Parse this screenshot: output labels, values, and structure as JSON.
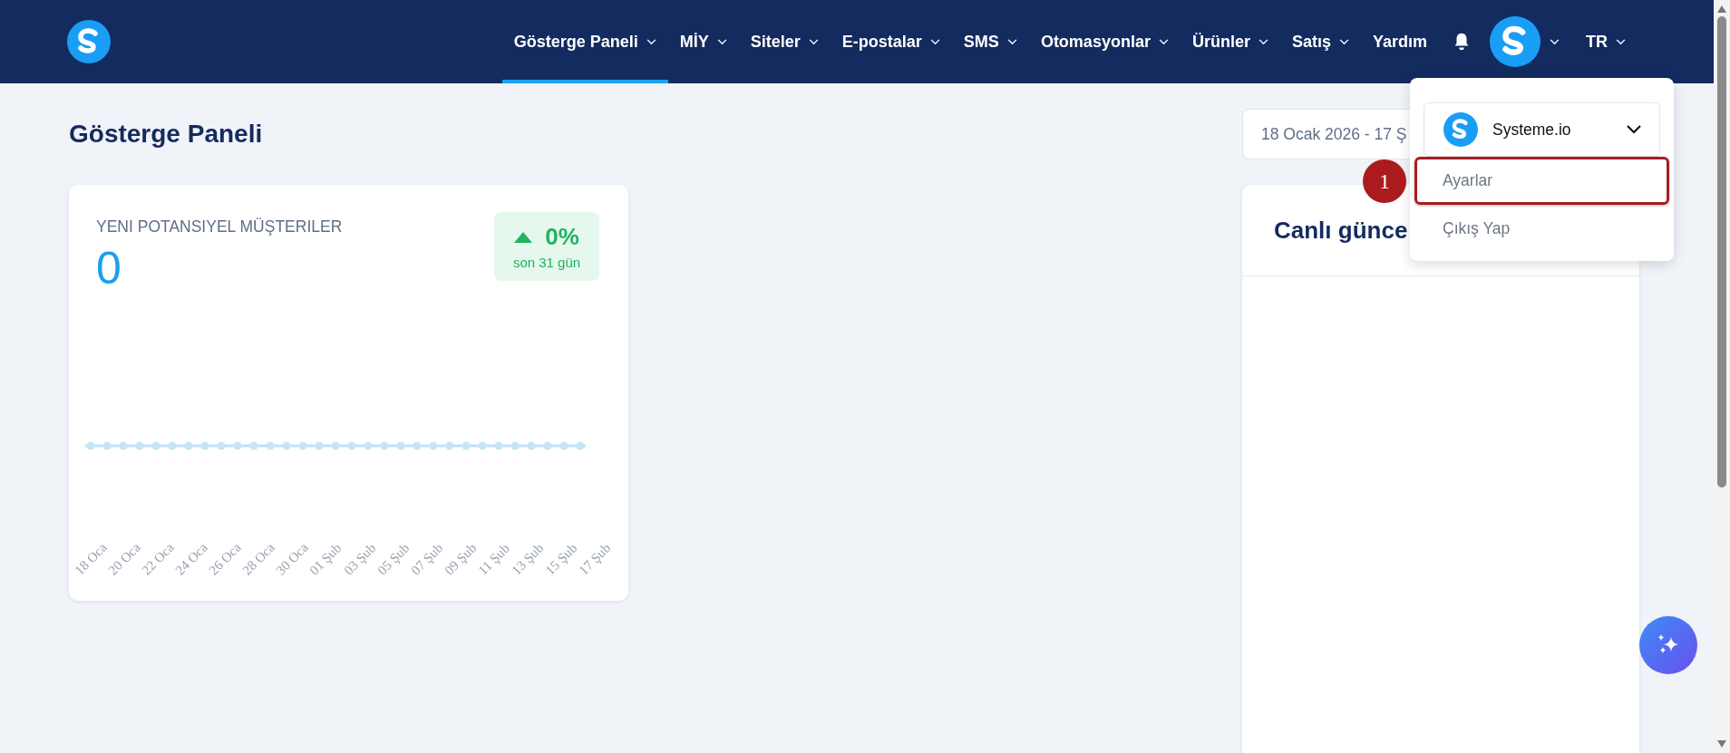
{
  "nav": {
    "items": [
      {
        "label": "Gösterge Paneli",
        "selected": true,
        "dropdown": true
      },
      {
        "label": "MİY",
        "selected": false,
        "dropdown": true
      },
      {
        "label": "Siteler",
        "selected": false,
        "dropdown": true
      },
      {
        "label": "E-postalar",
        "selected": false,
        "dropdown": true
      },
      {
        "label": "SMS",
        "selected": false,
        "dropdown": true
      },
      {
        "label": "Otomasyonlar",
        "selected": false,
        "dropdown": true
      },
      {
        "label": "Ürünler",
        "selected": false,
        "dropdown": true
      },
      {
        "label": "Satış",
        "selected": false,
        "dropdown": true
      },
      {
        "label": "Yardım",
        "selected": false,
        "dropdown": false
      }
    ],
    "language": "TR"
  },
  "page": {
    "title": "Gösterge Paneli",
    "date_range": "18 Ocak 2026 - 17 Ş"
  },
  "leads_card": {
    "title": "YENI POTANSIYEL MÜŞTERILER",
    "count": "0",
    "change": {
      "value": "0%",
      "period": "son 31 gün",
      "increase": true
    },
    "x_labels": [
      "18 Oca",
      "20 Oca",
      "22 Oca",
      "24 Oca",
      "26 Oca",
      "28 Oca",
      "30 Oca",
      "01 Şub",
      "03 Şub",
      "05 Şub",
      "07 Şub",
      "09 Şub",
      "11 Şub",
      "13 Şub",
      "15 Şub",
      "17 Şub"
    ]
  },
  "live_card": {
    "title": "Canlı günce"
  },
  "account_menu": {
    "account": "Systeme.io",
    "items": [
      {
        "label": "Ayarlar",
        "highlighted": true
      },
      {
        "label": "Çıkış Yap",
        "highlighted": false
      }
    ],
    "annotation": "1"
  }
}
